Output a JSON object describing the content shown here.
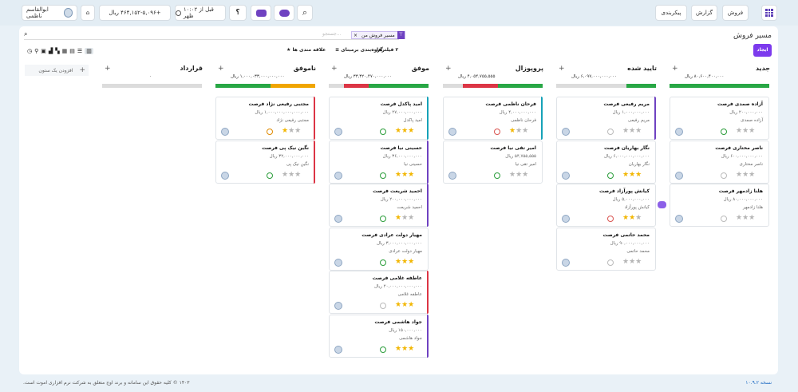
{
  "header": {
    "user_name": "ابوالقاسم ناظمی",
    "balance": "+۴۶۴,۱۵۲-۵,۰۹۶ ریال",
    "clock": "۱۰:۰۲ قبل از ظهر",
    "help_label": "؟",
    "nav": [
      "فروش",
      "گزارش",
      "پیکربندی"
    ]
  },
  "panel": {
    "title": "مسیر فروش",
    "filter_chip": "مسیر فروش من",
    "search_placeholder": "جستجو...",
    "create_label": "ایجاد",
    "filters_label": "۲ فیلترها",
    "group_label": "گروه‌بندی برمبنای",
    "favorites_label": "علاقه مندی ها",
    "add_column": "افزودن یک ستون"
  },
  "columns": [
    {
      "key": "new",
      "title": "جدید",
      "amount": "۸۰,۶۰۰,۴۰۰,۰۰۰ ریال",
      "progress": [
        {
          "color": "#28a745",
          "pct": 100
        }
      ],
      "cards": [
        {
          "title": "آزاده صمدی فرصت",
          "amount": "۲۰۰,۰۰۰,۰۰۰ ریال",
          "owner": "آزاده صمدی",
          "stars": 0,
          "act": "green"
        },
        {
          "title": "ناصر مختاری فرصت",
          "amount": "۶۰۰,۰۰۰,۰۰۰,۰۰۰ ریال",
          "owner": "ناصر مختاری",
          "stars": 0,
          "act": "grey"
        },
        {
          "title": "هلنا زادمهر فرصت",
          "amount": "۸۰,۰۰۰,۰۰۰,۰۰۰ ریال",
          "owner": "هلنا زادمهر",
          "stars": 0,
          "act": "grey"
        }
      ]
    },
    {
      "key": "approved",
      "title": "تایید شده",
      "amount": "۶,۰۹۷,۰۰۰,۰۰۰,۰۰۰ ریال",
      "progress": [
        {
          "color": "#28a745",
          "pct": 30
        },
        {
          "color": "#dcdcdc",
          "pct": 70
        }
      ],
      "cards": [
        {
          "title": "مریم رفیعی فرصت",
          "amount": "۱,۰۰۰,۰۰۰,۰۰۰ ریال",
          "owner": "مریم رفیعی",
          "stars": 0,
          "act": "grey",
          "stripe": "#6f42c1"
        },
        {
          "title": "نگار بهاریان فرصت",
          "amount": "۶,۰۰۰,۰۰۰,۰۰۰,۰۰۰ ریال",
          "owner": "نگار بهاریان",
          "stars": 3,
          "act": "green"
        },
        {
          "title": "کیانش پورآزاد فرصت",
          "amount": "۵,۰۰۰,۰۰۰,۰۰۰ ریال",
          "owner": "کیانش پورآزاد",
          "stars": 2,
          "act": "red"
        },
        {
          "title": "محمد حاتمی فرصت",
          "amount": "۹۰,۰۰۰,۰۰۰,۰۰۰ ریال",
          "owner": "محمد حاتمی",
          "stars": 0,
          "act": "grey"
        }
      ]
    },
    {
      "key": "proposal",
      "title": "پروپوزال",
      "amount": "۴,۰۵۴,۷۵۵,۵۵۵ ریال",
      "progress": [
        {
          "color": "#28a745",
          "pct": 45
        },
        {
          "color": "#dc3545",
          "pct": 35
        },
        {
          "color": "#dcdcdc",
          "pct": 20
        }
      ],
      "cards": [
        {
          "title": "فرحان ناظمی فرصت",
          "amount": "۴,۰۰۰,۰۰۰,۰۰۰ ریال",
          "owner": "فرحان ناظمی",
          "stars": 1,
          "act": "red",
          "stripe": "#17a2b8"
        },
        {
          "title": "امیر تقی نیا فرصت",
          "amount": "۵۴,۷۵۵,۵۵۵ ریال",
          "owner": "امیر تقی نیا",
          "stars": 0,
          "act": "green"
        }
      ]
    },
    {
      "key": "won",
      "title": "موفق",
      "amount": "۳۳,۳۲۰,۴۷۰,۰۰۰,۰۰۰ ریال",
      "progress": [
        {
          "color": "#28a745",
          "pct": 60
        },
        {
          "color": "#dc3545",
          "pct": 25
        },
        {
          "color": "#dcdcdc",
          "pct": 15
        }
      ],
      "cards": [
        {
          "title": "امید پاکدل فرصت",
          "amount": "۲۷,۰۰۰,۰۰۰,۰۰۰ ریال",
          "owner": "امید پاکدل",
          "stars": 3,
          "act": "green",
          "stripe": "#17a2b8"
        },
        {
          "title": "حسینی نیا فرصت",
          "amount": "۳۶,۰۰۰,۰۰۰,۰۰۰ ریال",
          "owner": "حسینی نیا",
          "stars": 3,
          "act": "green",
          "stripe": "#6f42c1"
        },
        {
          "title": "احمید شریعت فرصت",
          "amount": "۲۰۰,۰۰۰,۰۰۰,۰۰۰ ریال",
          "owner": "احمید شریعت",
          "stars": 1,
          "act": "green",
          "stripe": "#6f42c1"
        },
        {
          "title": "مهیار دولت عرادی فرصت",
          "amount": "۳,۰۰۰,۰۰۰,۰۰۰,۰۰۰ ریال",
          "owner": "مهیار دولت عرادی",
          "stars": 3,
          "act": "green"
        },
        {
          "title": "عاطفه غلامی فرصت",
          "amount": "۲۰,۰۰۰,۰۰۰,۰۰۰,۰۰۰ ریال",
          "owner": "عاطفه غلامی",
          "stars": 3,
          "act": "grey",
          "stripe": "#dc3545"
        },
        {
          "title": "جواد هاشمی فرصت",
          "amount": "۱۵۰,۰۰۰,۰۰۰ ریال",
          "owner": "جواد هاشمی",
          "stars": 3,
          "act": "green",
          "stripe": "#6f42c1"
        }
      ]
    },
    {
      "key": "lost",
      "title": "ناموفق",
      "amount": "۱,۰۰۰,۰۳۳,۰۰۰,۰۰۰,۰۰۰ ریال",
      "progress": [
        {
          "color": "#f0a500",
          "pct": 45
        },
        {
          "color": "#28a745",
          "pct": 55
        }
      ],
      "cards": [
        {
          "title": "مجتبی رفیعی نژاد فرصت",
          "amount": "۱,۰۰۰,۰۰۰,۰۰۰,۰۰۰,۰۰۰ ریال",
          "owner": "مجتبی رفیعی نژاد",
          "stars": 1,
          "act": "orange",
          "stripe": "#dc3545"
        },
        {
          "title": "نگین نیک پی فرصت",
          "amount": "۳۲,۰۰۰,۰۰۰,۰۰۰ ریال",
          "owner": "نگین نیک پی",
          "stars": 0,
          "act": "green",
          "stripe": "#dc3545"
        }
      ]
    },
    {
      "key": "contract",
      "title": "قرارداد",
      "amount": "۰",
      "progress": [
        {
          "color": "#dcdcdc",
          "pct": 100
        }
      ],
      "cards": []
    }
  ],
  "footer": {
    "copyright": "۱۴۰۳ © کلیه حقوق این سامانه و برند اوج متعلق به شرکت نرم افزاری اموت است.",
    "version": "نسخه ۱۰.۹.۲"
  }
}
